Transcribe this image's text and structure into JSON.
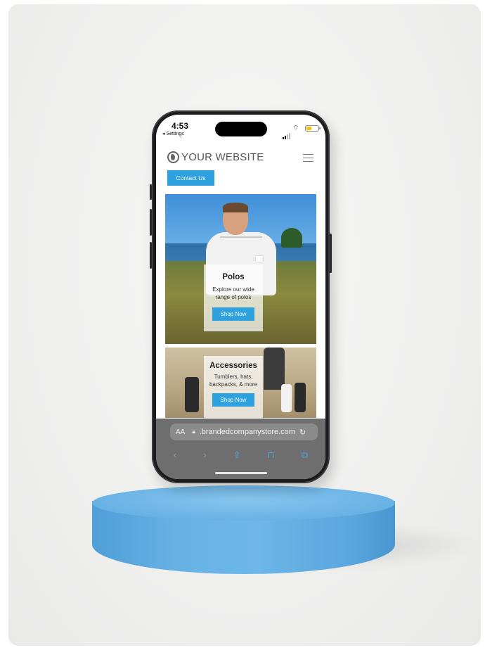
{
  "status_bar": {
    "time": "4:53",
    "back_label": "◂ Settings",
    "battery_level": 0.45,
    "battery_color": "#f1c40f"
  },
  "header": {
    "site_title": "YOUR WEBSITE",
    "logo_icon": "globe-icon",
    "menu_icon": "hamburger-icon"
  },
  "contact_button": {
    "label": "Contact Us"
  },
  "products": [
    {
      "title": "Polos",
      "description": "Explore our wide range of polos",
      "button": "Shop Now"
    },
    {
      "title": "Accessories",
      "description": "Tumblers, hats, backpacks, & more",
      "button": "Shop Now"
    }
  ],
  "browser": {
    "text_size_label": "AA",
    "url": ".brandedcompanystore.com",
    "nav_icons": [
      "back-icon",
      "forward-icon",
      "share-icon",
      "bookmarks-icon",
      "tabs-icon"
    ]
  },
  "colors": {
    "accent": "#2ea1df",
    "pedestal": "#6cb6e8",
    "phone_frame": "#1c1c1e"
  }
}
